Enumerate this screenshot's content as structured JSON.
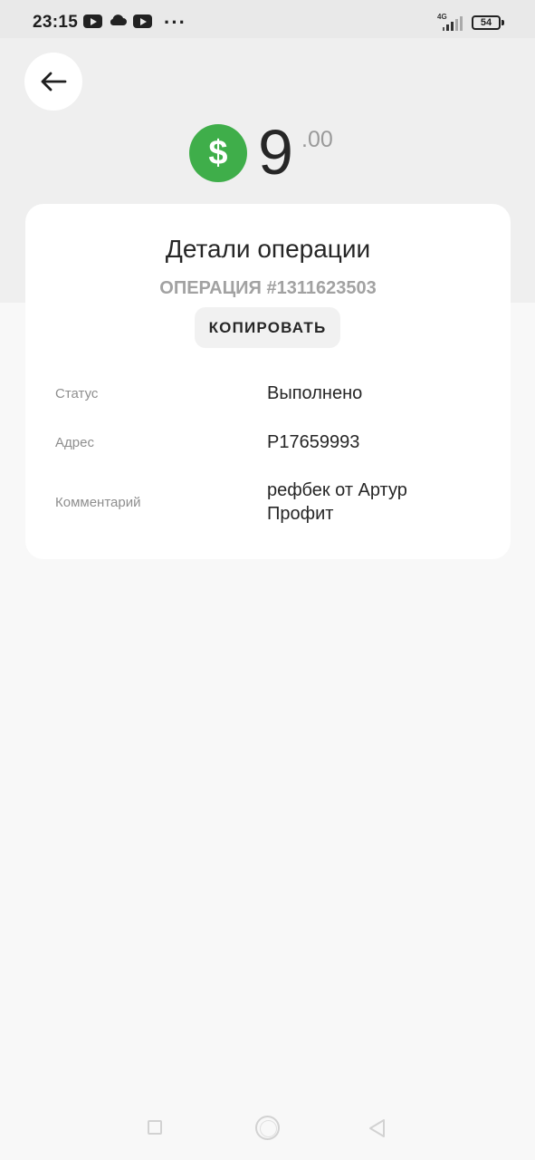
{
  "status_bar": {
    "time": "23:15",
    "network": "4G",
    "battery": "54",
    "more": "···"
  },
  "colors": {
    "accent_green": "#3fae4a",
    "text_primary": "#262626",
    "text_muted": "#8e8e8e"
  },
  "header": {
    "back_icon": "arrow-left-icon"
  },
  "amount": {
    "currency_icon": "$",
    "integer": "9",
    "fraction": ".00"
  },
  "details": {
    "title": "Детали операции",
    "operation_number": "ОПЕРАЦИЯ #1311623503",
    "copy_label": "КОПИРОВАТЬ",
    "rows": [
      {
        "label": "Статус",
        "value": "Выполнено"
      },
      {
        "label": "Адрес",
        "value": "P17659993"
      },
      {
        "label": "Комментарий",
        "value": "рефбек от Артур Профит"
      }
    ]
  }
}
